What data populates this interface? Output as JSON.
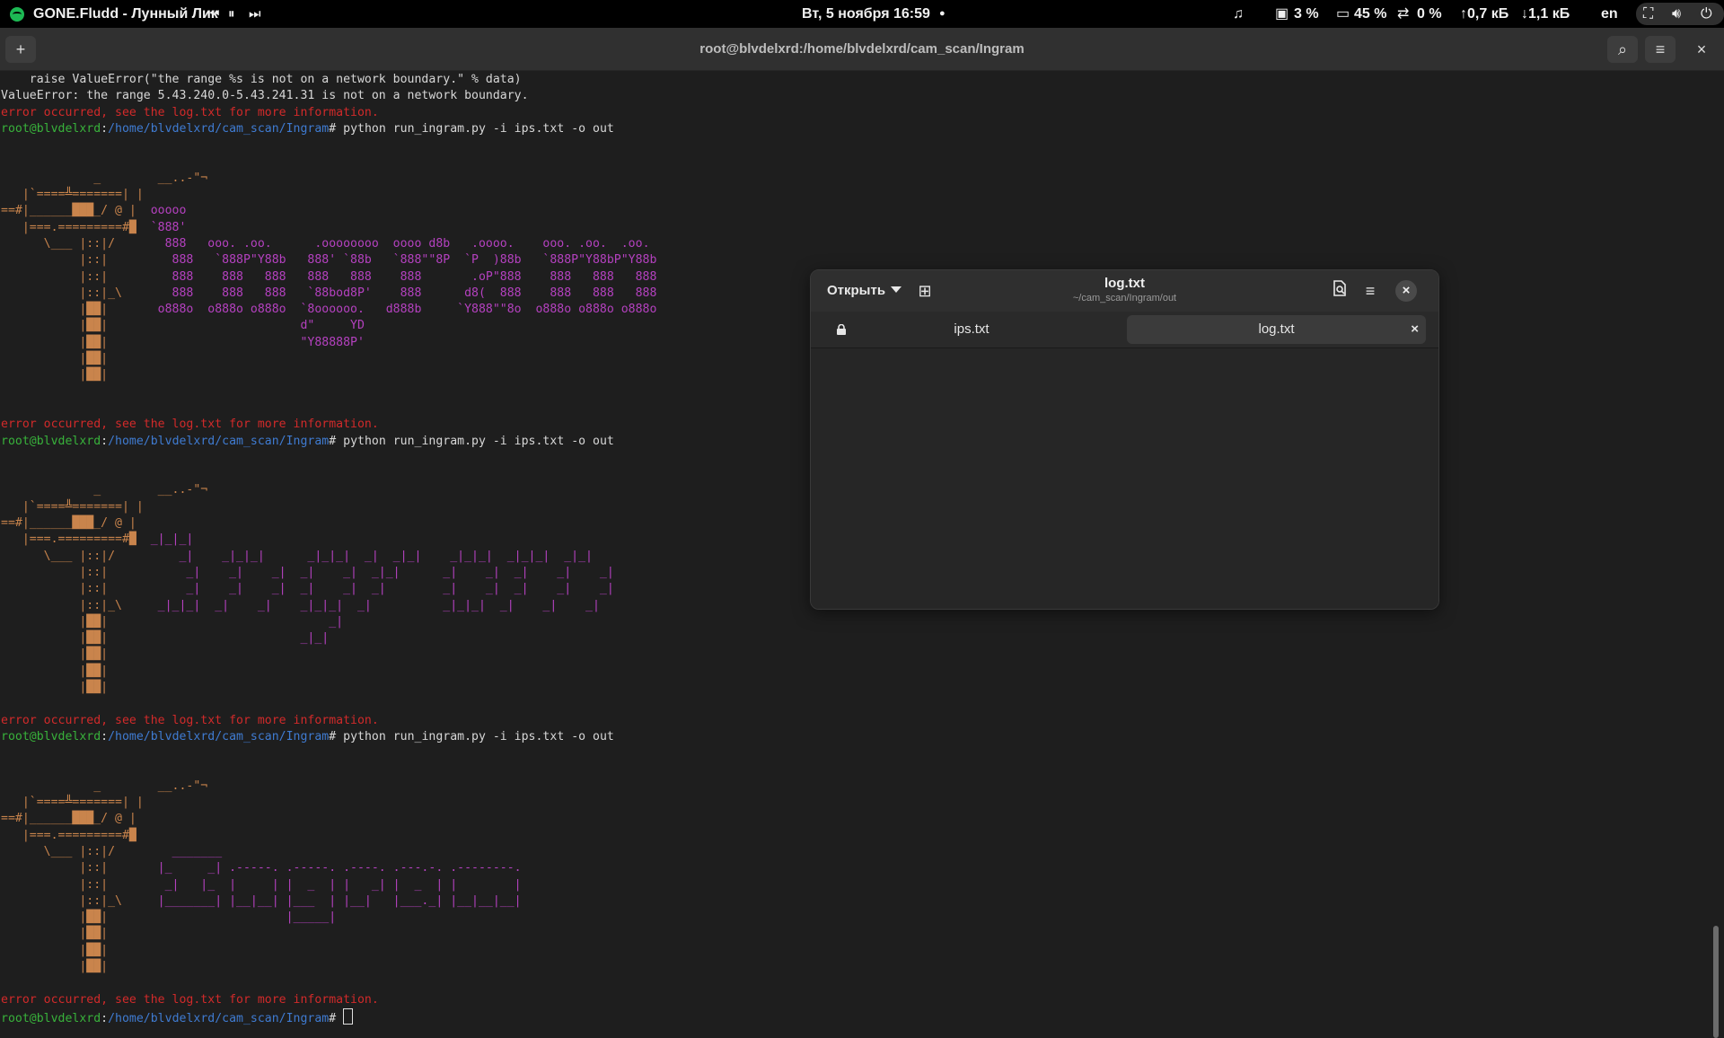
{
  "topbar": {
    "music_title": "GONE.Fludd - Лунный Лик",
    "media": {
      "prev": "⏮",
      "pause": "⏸",
      "next": "⏭"
    },
    "clock": "Вт, 5 ноября  16:59",
    "dot": "●",
    "indicators": {
      "cpu": "3 %",
      "mem": "45 %",
      "swap": "0 %",
      "upload": "↑0,7 кБ",
      "download": "↓1,1 кБ",
      "lang": "en"
    },
    "icons": [
      "spotify-icon",
      "music-icon",
      "cpu-icon",
      "memory-icon",
      "swap-icon",
      "network-icon",
      "volume-icon",
      "power-icon"
    ]
  },
  "terminal": {
    "title": "root@blvdelxrd:/home/blvdelxrd/cam_scan/Ingram",
    "new_tab": "+",
    "search": "⌕",
    "menu": "≡",
    "close": "×",
    "lines": [
      {
        "segs": [
          {
            "t": "    raise ValueError(\"the range %s is not on a network boundary.\" % data)",
            "c": ""
          }
        ]
      },
      {
        "segs": [
          {
            "t": "ValueError: the range 5.43.240.0-5.43.241.31 is not on a network boundary.",
            "c": ""
          }
        ]
      },
      {
        "segs": [
          {
            "t": "error occurred, see the log.txt for more information.",
            "c": "red"
          }
        ]
      },
      {
        "segs": [
          {
            "t": "root@blvdelxrd",
            "c": "green"
          },
          {
            "t": ":",
            "c": ""
          },
          {
            "t": "/home/blvdelxrd/cam_scan/Ingram",
            "c": "blue"
          },
          {
            "t": "# python run_ingram.py -i ips.txt -o out",
            "c": ""
          }
        ]
      },
      {
        "segs": [
          {
            "t": "",
            "c": ""
          }
        ]
      },
      {
        "segs": [
          {
            "t": "",
            "c": ""
          }
        ]
      },
      {
        "segs": [
          {
            "t": "             _        __..-\"¬",
            "c": "orange"
          }
        ]
      },
      {
        "segs": [
          {
            "t": "   |`====╩=======| |",
            "c": "orange"
          }
        ]
      },
      {
        "segs": [
          {
            "t": "==#|______███_/ @ |  ",
            "c": "orange"
          },
          {
            "t": "ooooo",
            "c": "purple"
          }
        ]
      },
      {
        "segs": [
          {
            "t": "   |===.=========#█  ",
            "c": "orange"
          },
          {
            "t": "`888'",
            "c": "purple"
          }
        ]
      },
      {
        "segs": [
          {
            "t": "      \\___ |::|/     ",
            "c": "orange"
          },
          {
            "t": "  888   ooo. .oo.      .oooooooo  oooo d8b   .oooo.    ooo. .oo.  .oo.",
            "c": "purple"
          }
        ]
      },
      {
        "segs": [
          {
            "t": "           |::|       ",
            "c": "orange"
          },
          {
            "t": "  888   `888P\"Y88b   888' `88b   `888\"\"8P  `P  )88b   `888P\"Y88bP\"Y88b",
            "c": "purple"
          }
        ]
      },
      {
        "segs": [
          {
            "t": "           |::|       ",
            "c": "orange"
          },
          {
            "t": "  888    888   888   888   888    888       .oP\"888    888   888   888",
            "c": "purple"
          }
        ]
      },
      {
        "segs": [
          {
            "t": "           |::|_\\     ",
            "c": "orange"
          },
          {
            "t": "  888    888   888   `88bod8P'    888      d8(  888    888   888   888",
            "c": "purple"
          }
        ]
      },
      {
        "segs": [
          {
            "t": "           |██|       ",
            "c": "orange"
          },
          {
            "t": "o888o  o888o o888o  `8oooooo.   d888b     `Y888\"\"8o  o888o o888o o888o",
            "c": "purple"
          }
        ]
      },
      {
        "segs": [
          {
            "t": "           |██|       ",
            "c": "orange"
          },
          {
            "t": "                    d\"     YD",
            "c": "purple"
          }
        ]
      },
      {
        "segs": [
          {
            "t": "           |██|       ",
            "c": "orange"
          },
          {
            "t": "                    \"Y88888P'",
            "c": "purple"
          }
        ]
      },
      {
        "segs": [
          {
            "t": "           |██|",
            "c": "orange"
          }
        ]
      },
      {
        "segs": [
          {
            "t": "           |██|",
            "c": "orange"
          }
        ]
      },
      {
        "segs": [
          {
            "t": "",
            "c": ""
          }
        ]
      },
      {
        "segs": [
          {
            "t": "",
            "c": ""
          }
        ]
      },
      {
        "segs": [
          {
            "t": "error occurred, see the log.txt for more information.",
            "c": "red"
          }
        ]
      },
      {
        "segs": [
          {
            "t": "root@blvdelxrd",
            "c": "green"
          },
          {
            "t": ":",
            "c": ""
          },
          {
            "t": "/home/blvdelxrd/cam_scan/Ingram",
            "c": "blue"
          },
          {
            "t": "# python run_ingram.py -i ips.txt -o out",
            "c": ""
          }
        ]
      },
      {
        "segs": [
          {
            "t": "",
            "c": ""
          }
        ]
      },
      {
        "segs": [
          {
            "t": "",
            "c": ""
          }
        ]
      },
      {
        "segs": [
          {
            "t": "             _        __..-\"¬",
            "c": "orange"
          }
        ]
      },
      {
        "segs": [
          {
            "t": "   |`====╩=======| |",
            "c": "orange"
          }
        ]
      },
      {
        "segs": [
          {
            "t": "==#|______███_/ @ |  ",
            "c": "orange"
          }
        ]
      },
      {
        "segs": [
          {
            "t": "   |===.=========#█  ",
            "c": "orange"
          },
          {
            "t": "_|_|_|",
            "c": "purple"
          }
        ]
      },
      {
        "segs": [
          {
            "t": "      \\___ |::|/     ",
            "c": "orange"
          },
          {
            "t": "    _|    _|_|_|      _|_|_|  _|  _|_|    _|_|_|  _|_|_|  _|_|",
            "c": "purple"
          }
        ]
      },
      {
        "segs": [
          {
            "t": "           |::|       ",
            "c": "orange"
          },
          {
            "t": "    _|    _|    _|  _|    _|  _|_|      _|    _|  _|    _|    _|",
            "c": "purple"
          }
        ]
      },
      {
        "segs": [
          {
            "t": "           |::|       ",
            "c": "orange"
          },
          {
            "t": "    _|    _|    _|  _|    _|  _|        _|    _|  _|    _|    _|",
            "c": "purple"
          }
        ]
      },
      {
        "segs": [
          {
            "t": "           |::|_\\     ",
            "c": "orange"
          },
          {
            "t": "_|_|_|  _|    _|    _|_|_|  _|          _|_|_|  _|    _|    _|",
            "c": "purple"
          }
        ]
      },
      {
        "segs": [
          {
            "t": "           |██|       ",
            "c": "orange"
          },
          {
            "t": "                        _|",
            "c": "purple"
          }
        ]
      },
      {
        "segs": [
          {
            "t": "           |██|       ",
            "c": "orange"
          },
          {
            "t": "                    _|_|",
            "c": "purple"
          }
        ]
      },
      {
        "segs": [
          {
            "t": "           |██|",
            "c": "orange"
          }
        ]
      },
      {
        "segs": [
          {
            "t": "           |██|",
            "c": "orange"
          }
        ]
      },
      {
        "segs": [
          {
            "t": "           |██|",
            "c": "orange"
          }
        ]
      },
      {
        "segs": [
          {
            "t": "",
            "c": ""
          }
        ]
      },
      {
        "segs": [
          {
            "t": "error occurred, see the log.txt for more information.",
            "c": "red"
          }
        ]
      },
      {
        "segs": [
          {
            "t": "root@blvdelxrd",
            "c": "green"
          },
          {
            "t": ":",
            "c": ""
          },
          {
            "t": "/home/blvdelxrd/cam_scan/Ingram",
            "c": "blue"
          },
          {
            "t": "# python run_ingram.py -i ips.txt -o out",
            "c": ""
          }
        ]
      },
      {
        "segs": [
          {
            "t": "",
            "c": ""
          }
        ]
      },
      {
        "segs": [
          {
            "t": "",
            "c": ""
          }
        ]
      },
      {
        "segs": [
          {
            "t": "             _        __..-\"¬",
            "c": "orange"
          }
        ]
      },
      {
        "segs": [
          {
            "t": "   |`====╩=======| |",
            "c": "orange"
          }
        ]
      },
      {
        "segs": [
          {
            "t": "==#|______███_/ @ |",
            "c": "orange"
          }
        ]
      },
      {
        "segs": [
          {
            "t": "   |===.=========#█",
            "c": "orange"
          }
        ]
      },
      {
        "segs": [
          {
            "t": "      \\___ |::|/     ",
            "c": "orange"
          },
          {
            "t": "   _______",
            "c": "purple"
          }
        ]
      },
      {
        "segs": [
          {
            "t": "           |::|       ",
            "c": "orange"
          },
          {
            "t": "|_     _| .-----. .-----. .----. .---.-. .--------.",
            "c": "purple"
          }
        ]
      },
      {
        "segs": [
          {
            "t": "           |::|       ",
            "c": "orange"
          },
          {
            "t": " _|   |_  |     | |  _  | |   _| |  _  | |        |",
            "c": "purple"
          }
        ]
      },
      {
        "segs": [
          {
            "t": "           |::|_\\     ",
            "c": "orange"
          },
          {
            "t": "|_______| |__|__| |___  | |__|   |___._| |__|__|__|",
            "c": "purple"
          }
        ]
      },
      {
        "segs": [
          {
            "t": "           |██|       ",
            "c": "orange"
          },
          {
            "t": "                  |_____|",
            "c": "purple"
          }
        ]
      },
      {
        "segs": [
          {
            "t": "           |██|",
            "c": "orange"
          }
        ]
      },
      {
        "segs": [
          {
            "t": "           |██|",
            "c": "orange"
          }
        ]
      },
      {
        "segs": [
          {
            "t": "           |██|",
            "c": "orange"
          }
        ]
      },
      {
        "segs": [
          {
            "t": "",
            "c": ""
          }
        ]
      },
      {
        "segs": [
          {
            "t": "error occurred, see the log.txt for more information.",
            "c": "red"
          }
        ]
      },
      {
        "segs": [
          {
            "t": "root@blvdelxrd",
            "c": "green"
          },
          {
            "t": ":",
            "c": ""
          },
          {
            "t": "/home/blvdelxrd/cam_scan/Ingram",
            "c": "blue"
          },
          {
            "t": "# ",
            "c": ""
          }
        ],
        "cursor": true
      }
    ]
  },
  "editor": {
    "open_label": "Открыть",
    "title": "log.txt",
    "subtitle": "~/cam_scan/Ingram/out",
    "new_doc": "⊞",
    "close": "×",
    "tabs": [
      {
        "label": "ips.txt",
        "locked": true
      },
      {
        "label": "log.txt",
        "active": true,
        "close": "×"
      }
    ]
  },
  "colors": {
    "red": "#d12a2a",
    "green": "#38b23b",
    "blue": "#3f7bd1",
    "orange": "#c9844c",
    "purple": "#b441bf"
  }
}
